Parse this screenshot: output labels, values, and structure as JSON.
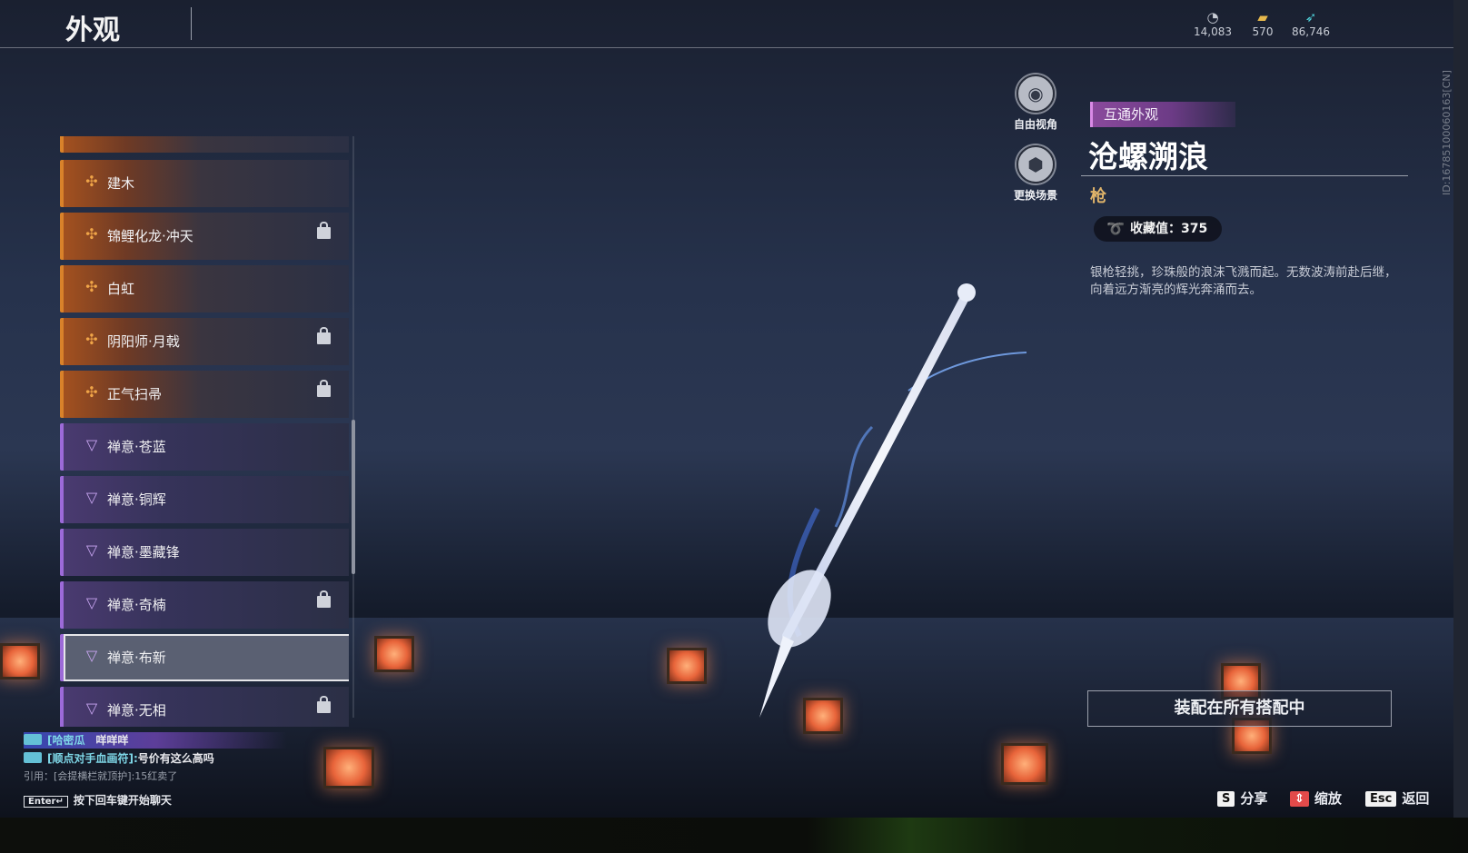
{
  "header": {
    "title": "外观"
  },
  "currencies": [
    {
      "icon": "coin-stack-icon",
      "value": "14,083"
    },
    {
      "icon": "gold-ticket-icon",
      "value": "570"
    },
    {
      "icon": "jade-feather-icon",
      "value": "86,746"
    }
  ],
  "list": {
    "items": [
      {
        "name": "",
        "rarity": "gold",
        "locked": false
      },
      {
        "name": "建木",
        "rarity": "gold",
        "locked": false
      },
      {
        "name": "锦鲤化龙·冲天",
        "rarity": "gold",
        "locked": true
      },
      {
        "name": "白虹",
        "rarity": "gold",
        "locked": false
      },
      {
        "name": "阴阳师·月戟",
        "rarity": "gold",
        "locked": true
      },
      {
        "name": "正气扫帚",
        "rarity": "gold",
        "locked": true
      },
      {
        "name": "禅意·苍蓝",
        "rarity": "purple",
        "locked": false
      },
      {
        "name": "禅意·铜辉",
        "rarity": "purple",
        "locked": false
      },
      {
        "name": "禅意·墨藏锋",
        "rarity": "purple",
        "locked": false
      },
      {
        "name": "禅意·奇楠",
        "rarity": "purple",
        "locked": true
      },
      {
        "name": "禅意·布新",
        "rarity": "purple",
        "locked": false,
        "selected": true
      },
      {
        "name": "禅意·无相",
        "rarity": "purple",
        "locked": true
      }
    ]
  },
  "side_buttons": {
    "free_view": "自由视角",
    "change_scene": "更换场景"
  },
  "detail": {
    "tag": "互通外观",
    "title": "沧螺溯浪",
    "type": "枪",
    "collect_value": "收藏值：375",
    "description": "银枪轻挑，珍珠般的浪沫飞溅而起。无数波涛前赴后继，向着远方渐亮的辉光奔涌而去。",
    "equip_button": "装配在所有搭配中",
    "id_text": "ID:1678510006016​3[CN]"
  },
  "footer": {
    "share": {
      "key": "S",
      "label": "分享"
    },
    "zoom": {
      "key": "⇕",
      "label": "缩放"
    },
    "back": {
      "key": "Esc",
      "label": "返回"
    }
  },
  "chat": {
    "line1": {
      "channel": "[哈密瓜",
      "text": "咩咩咩"
    },
    "line2": {
      "channel": "[顺点对手血画符]:",
      "text": "号价有这么高吗"
    },
    "line3": "引用：[会提横栏就顶护]:15红卖了",
    "input_key": "Enter↵",
    "input_hint": "按下回车键开始聊天"
  },
  "colors": {
    "gold_rarity": "#d9822a",
    "purple_rarity": "#9c6ad8",
    "tag": "#8a4a9c",
    "type_text": "#e0b46a"
  }
}
